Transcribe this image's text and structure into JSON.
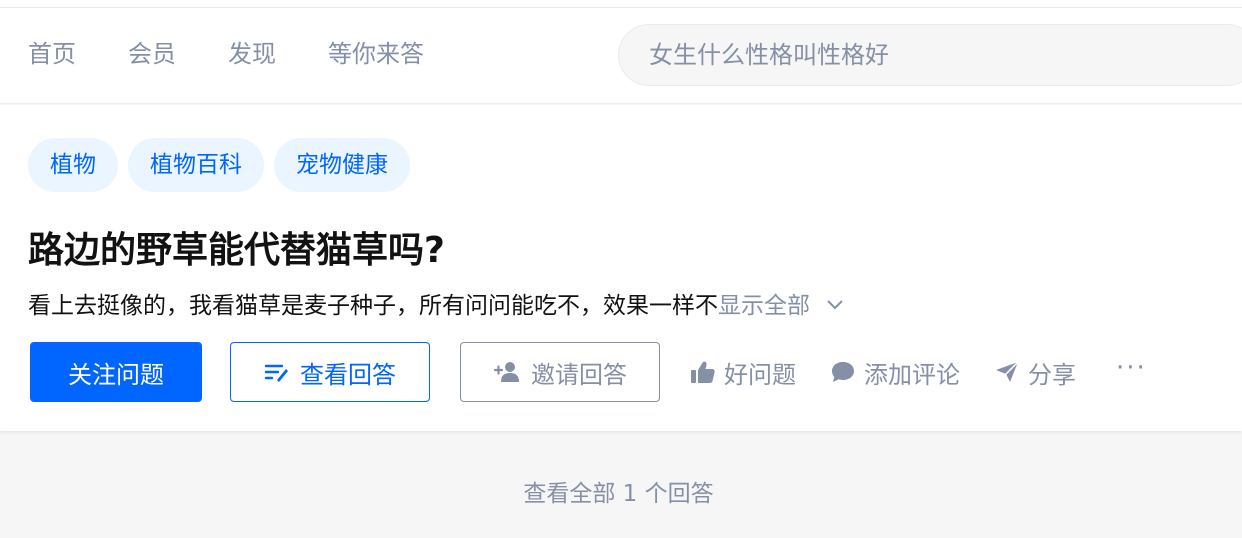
{
  "nav": {
    "items": [
      "首页",
      "会员",
      "发现",
      "等你来答"
    ]
  },
  "search": {
    "placeholder": "女生什么性格叫性格好"
  },
  "question": {
    "tags": [
      "植物",
      "植物百科",
      "宠物健康"
    ],
    "title": "路边的野草能代替猫草吗?",
    "excerpt": "看上去挺像的，我看猫草是麦子种子，所有问问能吃不，效果一样不",
    "show_all": "显示全部"
  },
  "actions": {
    "follow": "关注问题",
    "view_answers": "查看回答",
    "invite": "邀请回答",
    "good_question": "好问题",
    "add_comment": "添加评论",
    "share": "分享",
    "more": "···"
  },
  "footer": {
    "view_all": "查看全部 1 个回答"
  },
  "colors": {
    "accent": "#0066ff",
    "muted": "#8590a6",
    "tag_bg": "#ebf5ff"
  }
}
